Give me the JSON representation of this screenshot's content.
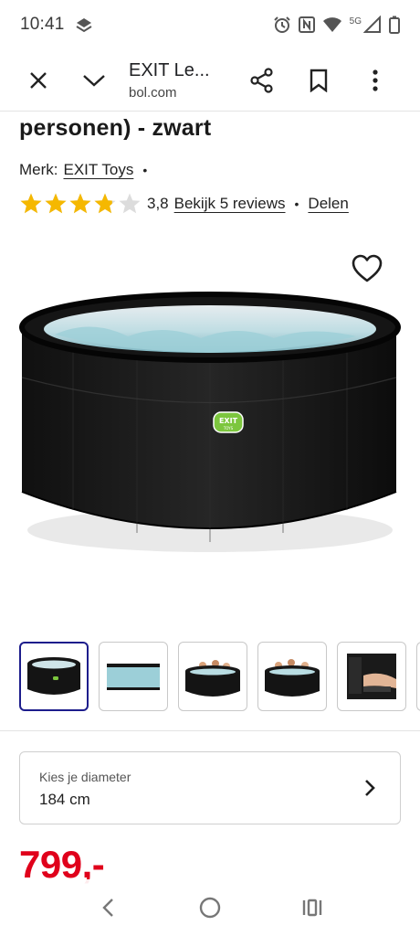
{
  "status_bar": {
    "time": "10:41",
    "network_label": "5G",
    "icons": [
      "alarm-icon",
      "nfc-icon",
      "wifi-icon",
      "signal-icon",
      "battery-icon"
    ]
  },
  "browser": {
    "page_title": "EXIT Le...",
    "host": "bol.com",
    "icons": [
      "close-icon",
      "chevron-down-icon",
      "share-icon",
      "bookmark-icon",
      "more-vert-icon"
    ]
  },
  "product": {
    "title_tail": "personen) - zwart",
    "brand_label": "Merk:",
    "brand_name": "EXIT Toys",
    "rating": "3,8",
    "rating_fraction": 0.76,
    "reviews_link": "Bekijk 5 reviews",
    "share_link": "Delen",
    "separator": "•",
    "image_logo_text": "EXIT",
    "image_logo_subtext": "TOYS"
  },
  "thumbnails": {
    "count_visible": 5,
    "items": [
      "thumb-spa-front",
      "thumb-spa-top",
      "thumb-spa-people-1",
      "thumb-spa-people-2",
      "thumb-spa-detail"
    ]
  },
  "diameter_selector": {
    "label": "Kies je diameter",
    "value": "184 cm"
  },
  "price": {
    "amount": "799,-",
    "color": "#e0001b"
  },
  "colors": {
    "star": "#f5b800",
    "star_empty": "#dcdcdc",
    "thumb_active_border": "#1d1d8c"
  }
}
